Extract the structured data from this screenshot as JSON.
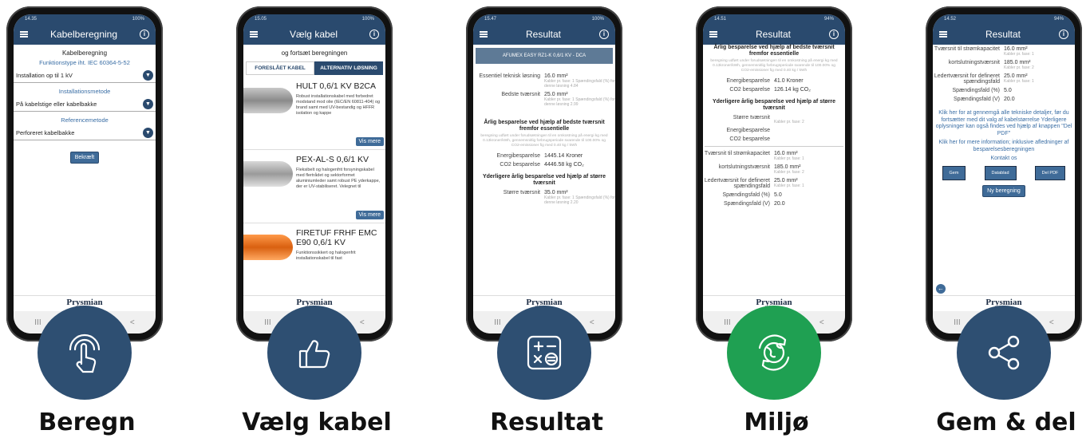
{
  "colors": {
    "navy": "#2e4f72",
    "green": "#1fa052",
    "appbar": "#2a4a6e"
  },
  "phones": [
    {
      "time": "14.35",
      "battery": "100%",
      "title": "Kabelberegning",
      "caption": "Beregn",
      "icon": "touch-icon"
    },
    {
      "time": "15.05",
      "battery": "100%",
      "title": "Vælg kabel",
      "caption": "Vælg kabel",
      "icon": "thumbs-up-icon"
    },
    {
      "time": "15.47",
      "battery": "100%",
      "title": "Resultat",
      "caption": "Resultat",
      "icon": "calculator-icon"
    },
    {
      "time": "14.51",
      "battery": "94%",
      "title": "Resultat",
      "caption": "Miljø",
      "icon": "globe-recycle-icon"
    },
    {
      "time": "14.52",
      "battery": "94%",
      "title": "Resultat",
      "caption": "Gem & del",
      "icon": "share-icon"
    }
  ],
  "brand": {
    "name": "Prysmian",
    "sub": "Group"
  },
  "nav": {
    "recent": "III",
    "back": "<"
  },
  "s1": {
    "heading": "Kabelberegning",
    "func_label": "Funktionstype iht. IEC 60364-5-52",
    "func_value": "Installation op til 1 kV",
    "method_label": "Installationsmetode",
    "method_value": "På kabelstige eller kabelbakke",
    "ref_label": "Referencemetode",
    "ref_value": "Perforeret kabelbakke",
    "confirm": "Bekræft"
  },
  "s2": {
    "intro": "og fortsæt beregningen",
    "tab1": "FORESLÅET KABEL",
    "tab2": "ALTERNATIV LØSNING",
    "cables": [
      {
        "name": "HULT 0,6/1 KV B2CA",
        "desc": "Robust installationskabel med forbedret modstand mod olie (IEC/EN 60811-404) og brand samt med UV-bestandig og HFFR isolation og kappe",
        "btn": "Vis mere"
      },
      {
        "name": "PEX-AL-S 0,6/1 KV",
        "desc": "Fleksibelt og halogenfrit forsyningskabel med flertrådet og sektorformet aluminiumleder samt robust PE yderkappe, der er UV-stabiliseret. Velegnet til",
        "btn": "Vis mere"
      },
      {
        "name": "FIRETUF FRHF EMC E90 0,6/1 KV",
        "desc": "Funktionssikkert og halogenfrit installationskabel til fast",
        "btn": ""
      }
    ]
  },
  "s3": {
    "header": "AFUMEX EASY RZ1-K 0,6/1 KV - DCA",
    "r1k": "Essentiel teknisk løsning",
    "r1v": "16.0 mm²",
    "r1n": "Kabler pr. fase: 1 Spændingsfald (%) for denne løsning 4.84",
    "r2k": "Bedste tværsnit",
    "r2v": "25.0 mm²",
    "r2n": "Kabler pr. fase: 1 Spændingsfald (%) for denne løsning 2.99",
    "sect1": "Årlig besparelse ved hjælp af bedste tværsnit fremfor essentielle",
    "fine1": "beregning udført under forudsætningen til en omkostning på energi kg med 0.13kroner/kWh, gennemsnitlig forbrugsperiode svarende til 100.00% og CO2-emissioner fig med 0.40 kg / kWh",
    "e1k": "Energibesparelse",
    "e1v": "1445.14 Kroner",
    "c1k": "CO2 besparelse",
    "c1v": "4446.58 kg CO₂",
    "sect2": "Yderligere årlig besparelse ved hjælp af større tværsnit",
    "t1k": "Større tværsnit",
    "t1v": "35.0 mm²",
    "t1n": "Kabler pr. fase: 1 Spændingsfald (%) for denne løsning 2.20"
  },
  "s4": {
    "sect1": "Årlig besparelse ved hjælp af bedste tværsnit fremfor essentielle",
    "fine1": "beregning udført under forudsætningen til en omkostning på energi kg med 0.13kroner/kWh, gennemsnitlig forbrugsperiode svarende til 100.00% og CO2-emissioner fig med 0.40 kg / kWh",
    "e1k": "Energibesparelse",
    "e1v": "41.0 Kroner",
    "c1k": "CO2 besparelse",
    "c1v": "126.14 kg CO₂",
    "sect2": "Yderligere årlig besparelse ved hjælp af større tværsnit",
    "t1k": "Større tværsnit",
    "t1n": "Kabler pr. fase: 2",
    "e2k": "Energibesparelse",
    "c2k": "CO2 besparelse",
    "x1k": "Tværsnit til strømkapacitet",
    "x1v": "16.0 mm²",
    "x1n": "Kabler pr. fase: 1",
    "x2k": "kortslutningstværsnit",
    "x2v": "185.0 mm²",
    "x2n": "Kabler pr. fase: 2",
    "x3k": "Ledertværsnit for defineret spændingsfald",
    "x3v": "25.0 mm²",
    "x3n": "Kabler pr. fase: 1",
    "x4k": "Spændingsfald (%)",
    "x4v": "5.0",
    "x5k": "Spændingsfald (V)",
    "x5v": "20.0"
  },
  "s5": {
    "x1k": "Tværsnit til strømkapacitet",
    "x1v": "16.0 mm²",
    "x1n": "Kabler pr. fase: 1",
    "x2k": "kortslutningstværsnit",
    "x2v": "185.0 mm²",
    "x2n": "Kabler pr. fase: 2",
    "x3k": "Ledertværsnit for defineret spændingsfald",
    "x3v": "25.0 mm²",
    "x3n": "Kabler pr. fase: 1",
    "x4k": "Spændingsfald (%)",
    "x4v": "5.0",
    "x5k": "Spændingsfald (V)",
    "x5v": "20.0",
    "link1": "Klik her for at gennemgå alle tekniske detaljer, før du fortsætter med dit valg af kabelstørrelse Yderligere oplysninger kan også findes ved hjælp af knappen \"Del PDF\"",
    "link2": "Klik her for mere information; inklusive afledninger af besparelsesberegningen",
    "contact": "Kontakt os",
    "b1": "Gem",
    "b2": "Datablad",
    "b3": "Del PDF",
    "newcalc": "Ny beregning"
  }
}
